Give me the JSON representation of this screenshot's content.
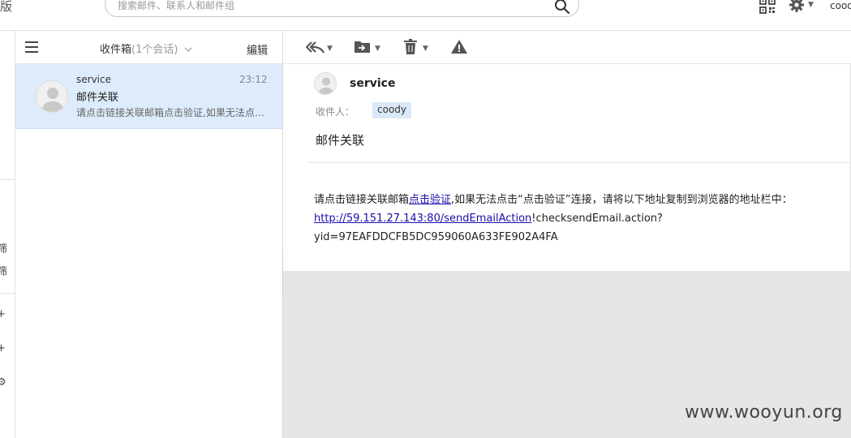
{
  "header": {
    "brand_fragment": "版",
    "search_placeholder": "搜索邮件、联系人和邮件组",
    "user_name": "cood"
  },
  "leftnav": {
    "glyphs": [
      "筛",
      "筛",
      "+",
      "+",
      "⚙"
    ]
  },
  "list": {
    "folder_title": "收件箱",
    "folder_count": "(1个会话)",
    "edit_label": "编辑",
    "items": [
      {
        "sender": "service",
        "time": "23:12",
        "subject": "邮件关联",
        "preview": "请点击链接关联邮箱点击验证,如果无法点击\"点击验证\"连接，请将以下地址复制到浏览器的地址栏"
      }
    ]
  },
  "reader": {
    "sender_name": "service",
    "recipient_label": "收件人：",
    "recipient": "coody",
    "subject": "邮件关联",
    "body_prefix": "请点击链接关联邮箱",
    "body_link1": "点击验证",
    "body_middle": ",如果无法点击“点击验证”连接，请将以下地址复制到浏览器的地址栏中：",
    "body_link2": "http://59.151.27.143:80/sendEmailAction",
    "body_suffix_line1": "!checksendEmail.action?",
    "body_suffix_line2": "yid=97EAFDDCFB5DC959060A633FE902A4FA"
  },
  "watermark": "www.wooyun.org",
  "icons": {
    "search": "search-icon",
    "qr": "qr-code-icon",
    "gear": "gear-icon",
    "menu": "menu-icon",
    "reply": "reply-all-icon",
    "move": "move-to-folder-icon",
    "delete": "trash-icon",
    "spam": "warning-icon",
    "avatar": "user-avatar-icon",
    "collapse": "chevron-right-icon"
  },
  "colors": {
    "selected_item": "#deebfb",
    "link": "#1a0dab",
    "gray_area": "#e6e6e6"
  }
}
